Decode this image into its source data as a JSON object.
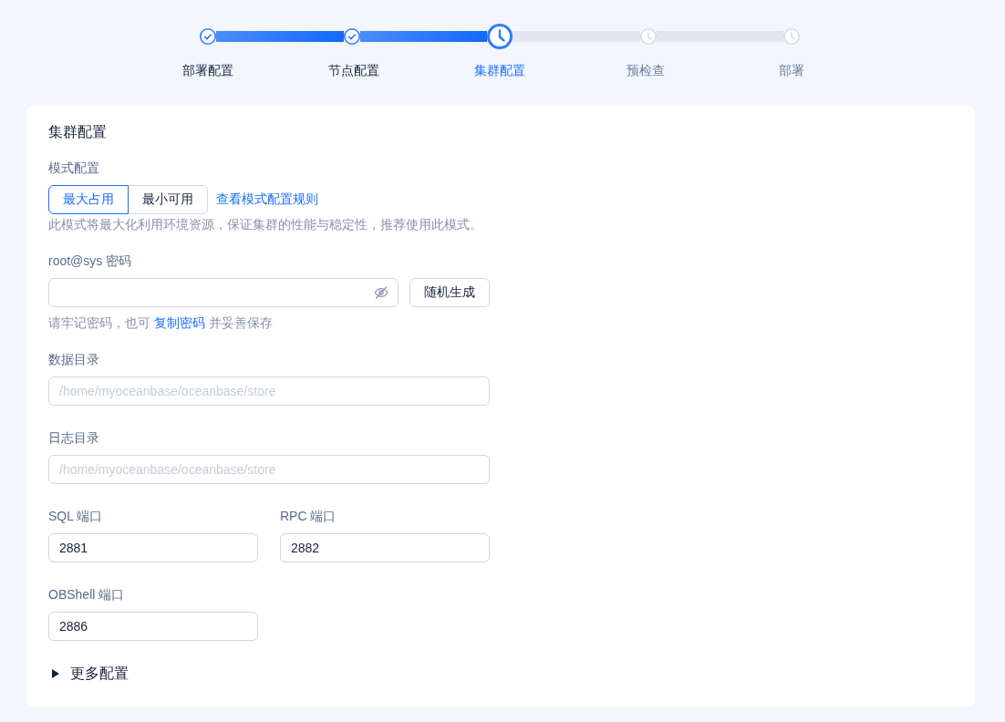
{
  "stepper": {
    "steps": [
      {
        "label": "部署配置",
        "completed": true,
        "selected": false
      },
      {
        "label": "节点配置",
        "completed": true,
        "selected": false
      },
      {
        "label": "集群配置",
        "completed": false,
        "selected": true
      },
      {
        "label": "预检查",
        "completed": false,
        "selected": false
      },
      {
        "label": "部署",
        "completed": false,
        "selected": false
      }
    ]
  },
  "form": {
    "title": "集群配置",
    "mode": {
      "label": "模式配置",
      "options": [
        {
          "label": "最大占用",
          "selected": true
        },
        {
          "label": "最小可用",
          "selected": false
        }
      ],
      "link": "查看模式配置规则",
      "description": "此模式将最大化利用环境资源，保证集群的性能与稳定性，推荐使用此模式。"
    },
    "password": {
      "label": "root@sys 密码",
      "visible": false,
      "button": "随机生成",
      "hint": {
        "before": "请牢记密码，也可 ",
        "link": "复制密码",
        "after": " 并妥善保存"
      }
    },
    "directories": [
      {
        "label": "数据目录",
        "placeholder": "/home/myoceanbase/oceanbase/store"
      },
      {
        "label": "日志目录",
        "placeholder": "/home/myoceanbase/oceanbase/store"
      }
    ],
    "ports": [
      {
        "label": "SQL 端口",
        "value": "2881"
      },
      {
        "label": "RPC 端口",
        "value": "2882"
      },
      {
        "label": "OBShell 端口",
        "value": "2886"
      }
    ],
    "more": {
      "label": "更多配置",
      "expanded": false
    }
  }
}
